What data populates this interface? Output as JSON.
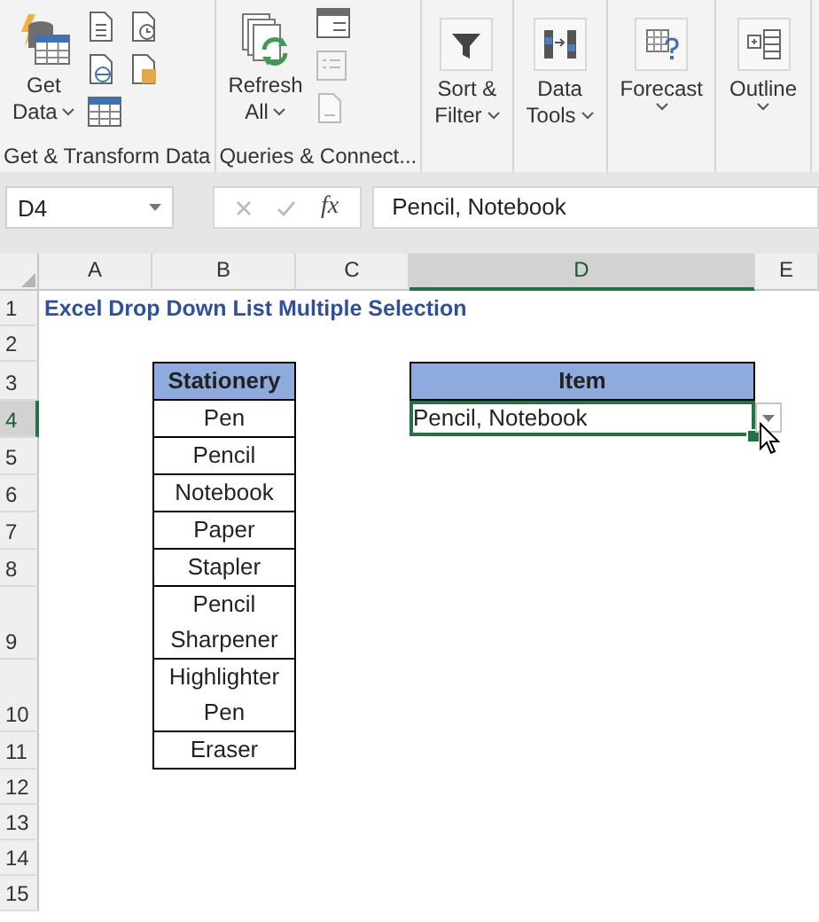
{
  "ribbon": {
    "groups": [
      {
        "label": "Get & Transform Data",
        "kind": "get-transform",
        "buttons": [
          {
            "label": "Get Data",
            "dropdown": true
          }
        ]
      },
      {
        "label": "Queries & Connect...",
        "kind": "queries",
        "buttons": [
          {
            "label": "Refresh All",
            "dropdown": true
          }
        ]
      },
      {
        "kind": "single",
        "buttons": [
          {
            "label": "Sort & Filter",
            "dropdown": true
          }
        ]
      },
      {
        "kind": "single",
        "buttons": [
          {
            "label": "Data Tools",
            "dropdown": true
          }
        ]
      },
      {
        "kind": "single",
        "buttons": [
          {
            "label": "Forecast",
            "dropdown": true
          }
        ]
      },
      {
        "kind": "single",
        "buttons": [
          {
            "label": "Outline",
            "dropdown": true
          }
        ]
      }
    ]
  },
  "formula_bar": {
    "name_box": "D4",
    "function_label": "fx",
    "formula": "Pencil, Notebook"
  },
  "sheet": {
    "columns": [
      {
        "label": "A",
        "selected": false
      },
      {
        "label": "B",
        "selected": false
      },
      {
        "label": "C",
        "selected": false
      },
      {
        "label": "D",
        "selected": true
      },
      {
        "label": "E",
        "selected": false
      }
    ],
    "rows": [
      {
        "number": "1",
        "selected": false
      },
      {
        "number": "2",
        "selected": false
      },
      {
        "number": "3",
        "selected": false
      },
      {
        "number": "4",
        "selected": true
      },
      {
        "number": "5",
        "selected": false
      },
      {
        "number": "6",
        "selected": false
      },
      {
        "number": "7",
        "selected": false
      },
      {
        "number": "8",
        "selected": false
      },
      {
        "number": "9",
        "selected": false
      },
      {
        "number": "10",
        "selected": false
      },
      {
        "number": "11",
        "selected": false
      },
      {
        "number": "12",
        "selected": false
      },
      {
        "number": "13",
        "selected": false
      },
      {
        "number": "14",
        "selected": false
      },
      {
        "number": "15",
        "selected": false
      }
    ],
    "title": "Excel Drop Down List Multiple Selection",
    "stationery_table": {
      "header": "Stationery",
      "items": [
        "Pen",
        "Pencil",
        "Notebook",
        "Paper",
        "Stapler",
        "Pencil Sharpener",
        "Highlighter Pen",
        "Eraser"
      ]
    },
    "item_table": {
      "header": "Item",
      "value": "Pencil, Notebook",
      "active": true,
      "dropdown": true
    }
  }
}
